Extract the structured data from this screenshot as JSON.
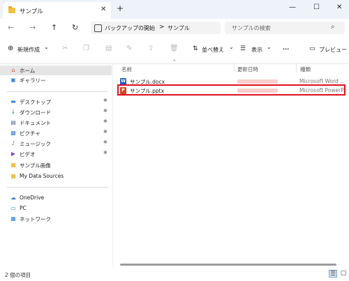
{
  "window": {
    "tab_title": "サンプル",
    "tab_close": "✕",
    "tab_add": "+",
    "minimize": "—",
    "maximize": "☐",
    "close": "✕"
  },
  "nav": {
    "back": "←",
    "forward": "→",
    "up": "↑",
    "refresh": "↻",
    "breadcrumb": [
      "バックアップの開始",
      "サンプル"
    ],
    "breadcrumb_sep": ">",
    "search_placeholder": "サンプルの検索",
    "search_icon": "⌕"
  },
  "toolbar": {
    "new_label": "新規作成",
    "new_caret": "⌄",
    "sort_label": "並べ替え",
    "view_label": "表示",
    "more_label": "···",
    "preview_label": "プレビュー"
  },
  "sidebar": {
    "home": "ホーム",
    "gallery": "ギャラリー",
    "quick": [
      {
        "label": "デスクトップ",
        "icon": "desktop-icon",
        "color": "#2a86d8"
      },
      {
        "label": "ダウンロード",
        "icon": "download-icon",
        "color": "#2a9a4a"
      },
      {
        "label": "ドキュメント",
        "icon": "documents-icon",
        "color": "#5a6a80"
      },
      {
        "label": "ピクチャ",
        "icon": "pictures-icon",
        "color": "#3a7fd4"
      },
      {
        "label": "ミュージック",
        "icon": "music-icon",
        "color": "#e0522a"
      },
      {
        "label": "ビデオ",
        "icon": "videos-icon",
        "color": "#7a4ad0"
      }
    ],
    "folders": [
      "サンプル画像",
      "My Data Sources"
    ],
    "onedrive": "OneDrive",
    "pc": "PC",
    "network": "ネットワーク"
  },
  "columns": {
    "name": "名前",
    "date": "更新日時",
    "type": "種類"
  },
  "files": [
    {
      "name": "サンプル.docx",
      "type": "Microsoft Word ...",
      "icon_color": "#2b5cb8",
      "icon_letter": "W"
    },
    {
      "name": "サンプル.pptx",
      "type": "Microsoft PowerP...",
      "icon_color": "#d24726",
      "icon_letter": "P"
    }
  ],
  "status": {
    "item_count": "2 個の項目"
  },
  "colors": {
    "highlight": "#e01020",
    "selection": "#e5e5e5"
  }
}
